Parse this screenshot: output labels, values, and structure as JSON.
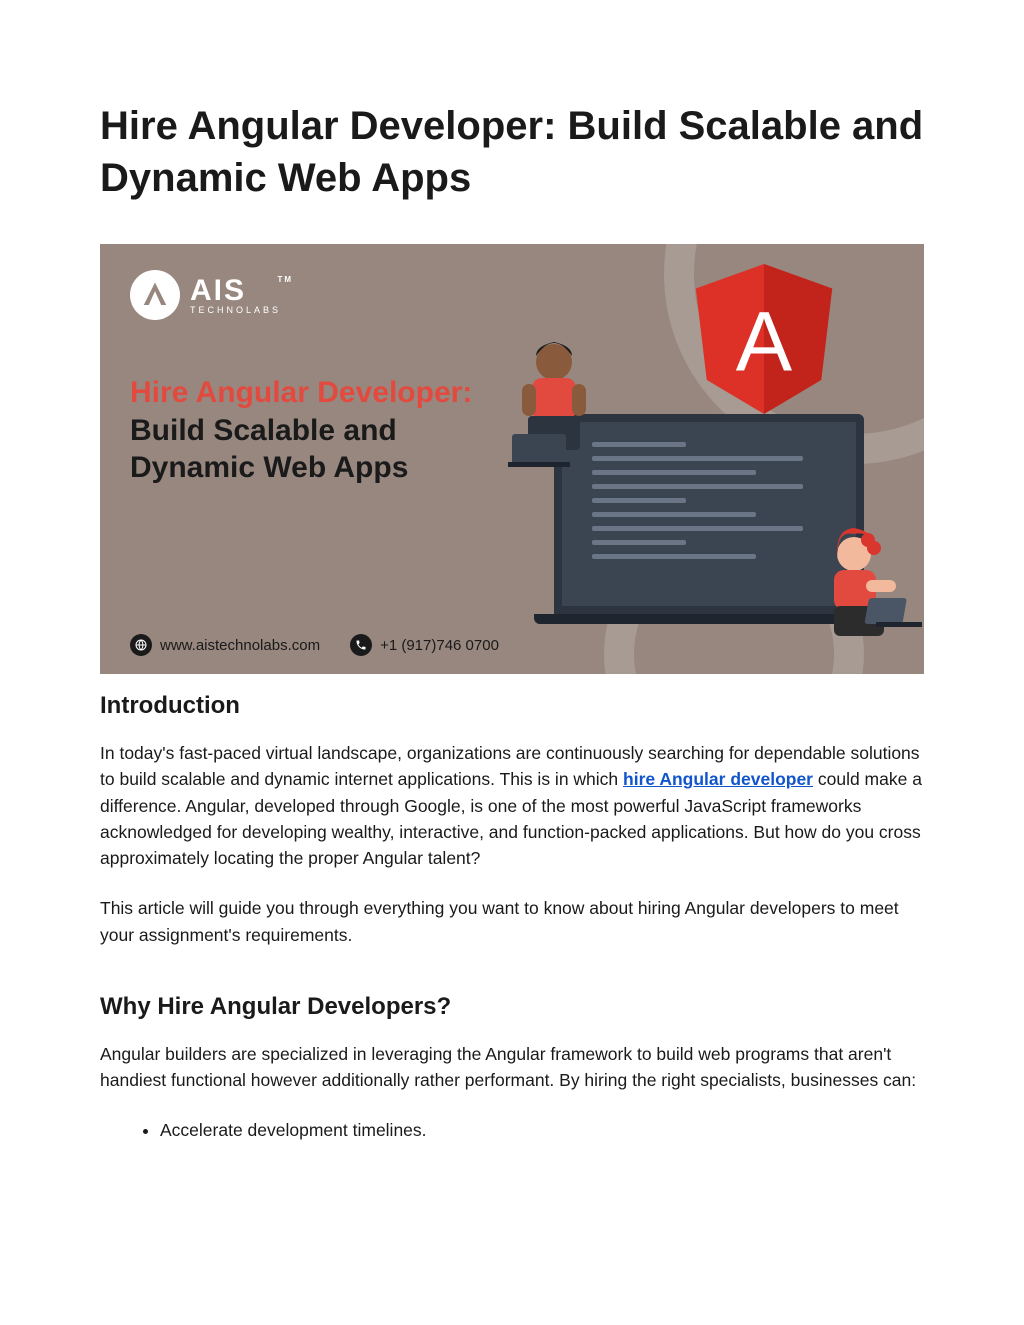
{
  "title": "Hire Angular Developer: Build Scalable and Dynamic Web Apps",
  "hero": {
    "logo_main": "AIS",
    "logo_sub": "TECHNOLABS",
    "logo_tm": "TM",
    "headline_red": "Hire Angular Developer:",
    "headline_black": " Build Scalable and Dynamic Web Apps",
    "website": "www.aistechnolabs.com",
    "phone": "+1 (917)746 0700",
    "angular_letter": "A"
  },
  "sections": {
    "intro": {
      "heading": "Introduction",
      "p1a": "In today's fast-paced virtual landscape, organizations are continuously searching for dependable solutions to build scalable and dynamic internet applications. This is in which ",
      "link_text": "hire Angular developer",
      "p1b": " could make a difference. Angular, developed through Google, is one of the most powerful JavaScript frameworks acknowledged for developing wealthy, interactive, and function-packed applications. But how do you cross approximately locating the proper Angular talent?",
      "p2": "This article will guide you through everything you want to know about hiring Angular developers to meet your assignment's requirements."
    },
    "why": {
      "heading": "Why Hire Angular Developers?",
      "p1": "Angular builders are specialized in leveraging the Angular framework to build web programs that aren't handiest functional however additionally rather performant. By hiring the right specialists, businesses can:",
      "bullets": [
        "Accelerate development timelines."
      ]
    }
  }
}
